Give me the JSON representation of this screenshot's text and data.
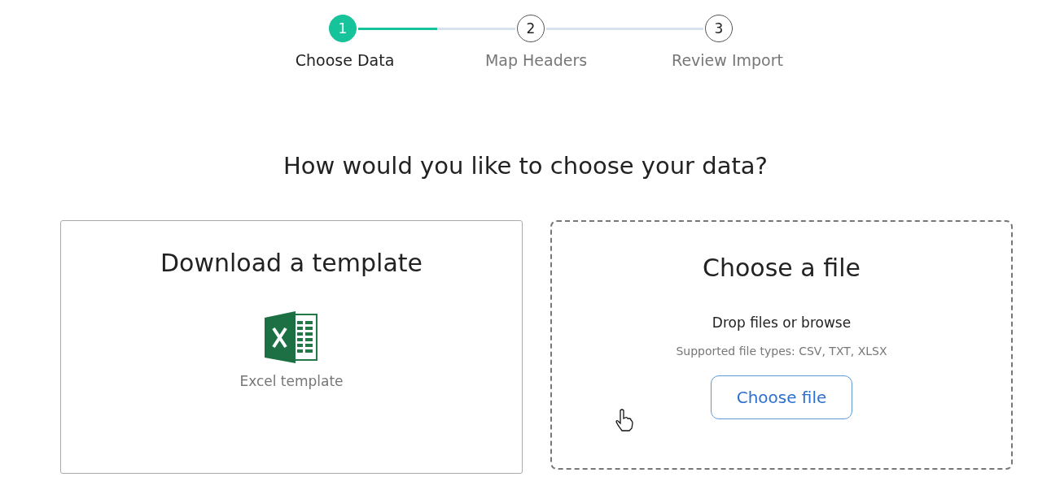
{
  "stepper": {
    "steps": [
      {
        "number": "1",
        "label": "Choose Data",
        "selected": true
      },
      {
        "number": "2",
        "label": "Map Headers",
        "selected": false
      },
      {
        "number": "3",
        "label": "Review Import",
        "selected": false
      }
    ],
    "progress": {
      "level": 0.5
    }
  },
  "heading": "How would you like to choose your data?",
  "template_card": {
    "title": "Download a template",
    "file_label": "Excel template"
  },
  "upload_card": {
    "title": "Choose a file",
    "prompt": "Drop files or browse",
    "hint": "Supported file types: CSV, TXT, XLSX",
    "button": "Choose file"
  }
}
